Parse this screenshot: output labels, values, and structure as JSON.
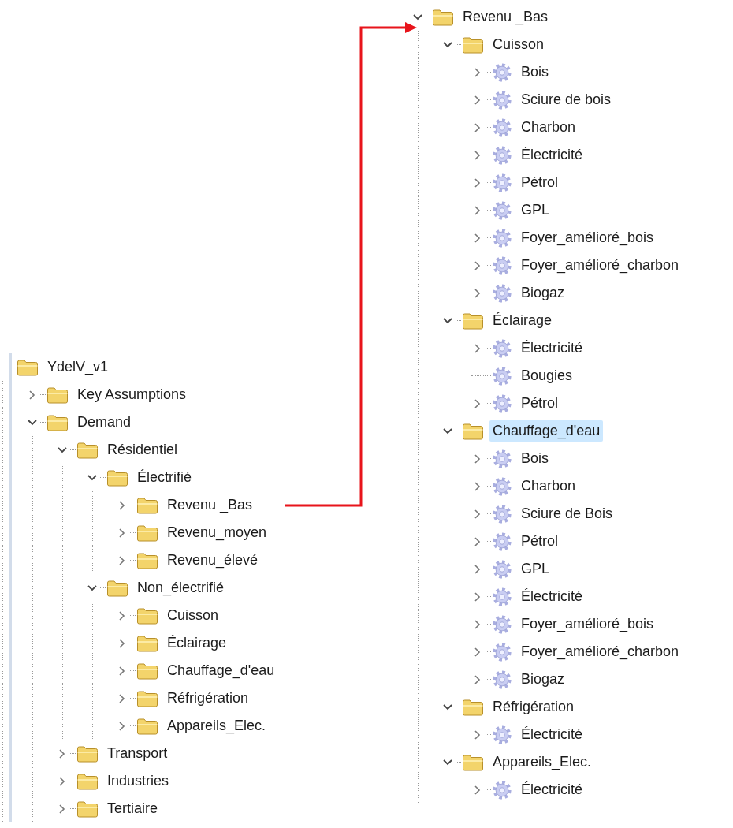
{
  "left_tree": [
    {
      "label": "YdelV_v1",
      "kind": "folder",
      "selected": false,
      "children": [
        {
          "label": "Key Assumptions",
          "kind": "folder",
          "expandable": true,
          "expanded": false,
          "selected": false
        },
        {
          "label": "Demand",
          "kind": "folder",
          "expandable": true,
          "expanded": true,
          "selected": false,
          "children": [
            {
              "label": "Résidentiel",
              "kind": "folder",
              "expandable": true,
              "expanded": true,
              "selected": false,
              "children": [
                {
                  "label": "Électrifié",
                  "kind": "folder",
                  "expandable": true,
                  "expanded": true,
                  "selected": false,
                  "children": [
                    {
                      "label": "Revenu _Bas",
                      "kind": "folder",
                      "expandable": true,
                      "expanded": false,
                      "selected": false
                    },
                    {
                      "label": "Revenu_moyen",
                      "kind": "folder",
                      "expandable": true,
                      "expanded": false,
                      "selected": false
                    },
                    {
                      "label": "Revenu_élevé",
                      "kind": "folder",
                      "expandable": true,
                      "expanded": false,
                      "selected": false
                    }
                  ]
                },
                {
                  "label": "Non_électrifié",
                  "kind": "folder",
                  "expandable": true,
                  "expanded": true,
                  "selected": false,
                  "children": [
                    {
                      "label": "Cuisson",
                      "kind": "folder",
                      "expandable": true,
                      "expanded": false,
                      "selected": false
                    },
                    {
                      "label": "Éclairage",
                      "kind": "folder",
                      "expandable": true,
                      "expanded": false,
                      "selected": false
                    },
                    {
                      "label": "Chauffage_d'eau",
                      "kind": "folder",
                      "expandable": true,
                      "expanded": false,
                      "selected": false
                    },
                    {
                      "label": "Réfrigération",
                      "kind": "folder",
                      "expandable": true,
                      "expanded": false,
                      "selected": false
                    },
                    {
                      "label": "Appareils_Elec.",
                      "kind": "folder",
                      "expandable": true,
                      "expanded": false,
                      "selected": false
                    }
                  ]
                }
              ]
            },
            {
              "label": "Transport",
              "kind": "folder",
              "expandable": true,
              "expanded": false,
              "selected": false
            },
            {
              "label": "Industries",
              "kind": "folder",
              "expandable": true,
              "expanded": false,
              "selected": false
            },
            {
              "label": "Tertiaire",
              "kind": "folder",
              "expandable": true,
              "expanded": false,
              "selected": false
            }
          ]
        }
      ]
    }
  ],
  "right_tree": [
    {
      "label": "Revenu _Bas",
      "kind": "folder",
      "expandable": true,
      "expanded": true,
      "selected": false,
      "children": [
        {
          "label": "Cuisson",
          "kind": "folder",
          "expandable": true,
          "expanded": true,
          "selected": false,
          "children": [
            {
              "label": "Bois",
              "kind": "item",
              "expandable": true,
              "expanded": false,
              "selected": false
            },
            {
              "label": "Sciure de bois",
              "kind": "item",
              "expandable": true,
              "expanded": false,
              "selected": false
            },
            {
              "label": "Charbon",
              "kind": "item",
              "expandable": true,
              "expanded": false,
              "selected": false
            },
            {
              "label": "Électricité",
              "kind": "item",
              "expandable": true,
              "expanded": false,
              "selected": false
            },
            {
              "label": "Pétrol",
              "kind": "item",
              "expandable": true,
              "expanded": false,
              "selected": false
            },
            {
              "label": "GPL",
              "kind": "item",
              "expandable": true,
              "expanded": false,
              "selected": false
            },
            {
              "label": "Foyer_amélioré_bois",
              "kind": "item",
              "expandable": true,
              "expanded": false,
              "selected": false
            },
            {
              "label": "Foyer_amélioré_charbon",
              "kind": "item",
              "expandable": true,
              "expanded": false,
              "selected": false
            },
            {
              "label": "Biogaz",
              "kind": "item",
              "expandable": true,
              "expanded": false,
              "selected": false
            }
          ]
        },
        {
          "label": "Éclairage",
          "kind": "folder",
          "expandable": true,
          "expanded": true,
          "selected": false,
          "children": [
            {
              "label": "Électricité",
              "kind": "item",
              "expandable": true,
              "expanded": false,
              "selected": false
            },
            {
              "label": "Bougies",
              "kind": "item",
              "expandable": false,
              "selected": false
            },
            {
              "label": "Pétrol",
              "kind": "item",
              "expandable": true,
              "expanded": false,
              "selected": false
            }
          ]
        },
        {
          "label": "Chauffage_d'eau",
          "kind": "folder",
          "expandable": true,
          "expanded": true,
          "selected": true,
          "children": [
            {
              "label": "Bois",
              "kind": "item",
              "expandable": true,
              "expanded": false,
              "selected": false
            },
            {
              "label": "Charbon",
              "kind": "item",
              "expandable": true,
              "expanded": false,
              "selected": false
            },
            {
              "label": "Sciure de Bois",
              "kind": "item",
              "expandable": true,
              "expanded": false,
              "selected": false
            },
            {
              "label": "Pétrol",
              "kind": "item",
              "expandable": true,
              "expanded": false,
              "selected": false
            },
            {
              "label": "GPL",
              "kind": "item",
              "expandable": true,
              "expanded": false,
              "selected": false
            },
            {
              "label": "Électricité",
              "kind": "item",
              "expandable": true,
              "expanded": false,
              "selected": false
            },
            {
              "label": "Foyer_amélioré_bois",
              "kind": "item",
              "expandable": true,
              "expanded": false,
              "selected": false
            },
            {
              "label": "Foyer_amélioré_charbon",
              "kind": "item",
              "expandable": true,
              "expanded": false,
              "selected": false
            },
            {
              "label": "Biogaz",
              "kind": "item",
              "expandable": true,
              "expanded": false,
              "selected": false
            }
          ]
        },
        {
          "label": "Réfrigération",
          "kind": "folder",
          "expandable": true,
          "expanded": true,
          "selected": false,
          "children": [
            {
              "label": "Électricité",
              "kind": "item",
              "expandable": true,
              "expanded": false,
              "selected": false
            }
          ]
        },
        {
          "label": "Appareils_Elec.",
          "kind": "folder",
          "expandable": true,
          "expanded": true,
          "selected": false,
          "children": [
            {
              "label": "Électricité",
              "kind": "item",
              "expandable": true,
              "expanded": false,
              "selected": false
            }
          ]
        }
      ]
    }
  ]
}
